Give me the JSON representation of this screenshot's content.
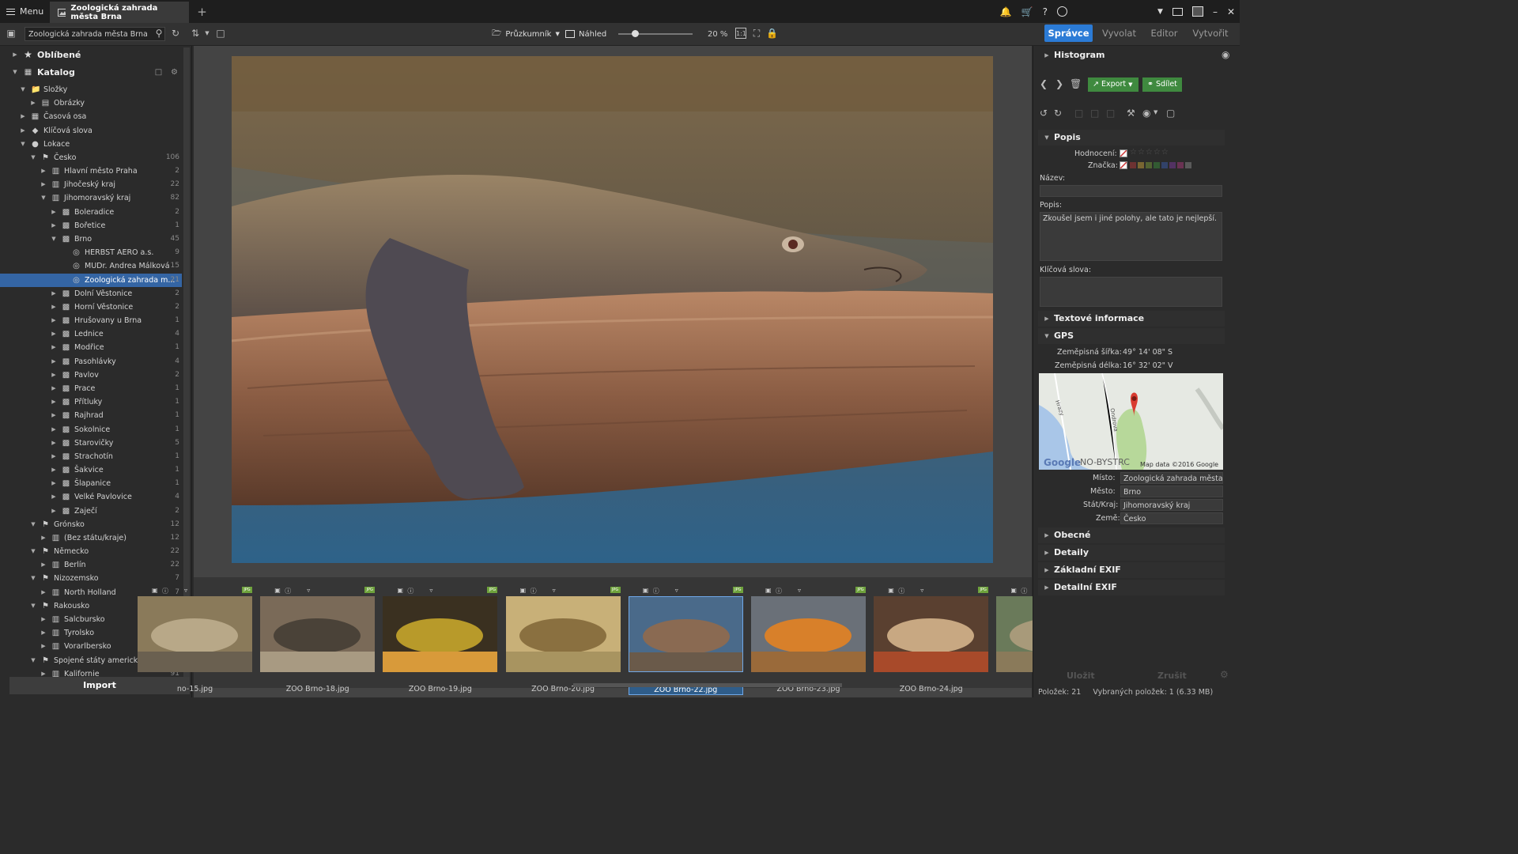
{
  "titlebar": {
    "menu_label": "Menu",
    "tab_title": "Zoologická zahrada města Brna",
    "icons": [
      "bell-icon",
      "cart-icon",
      "help-icon",
      "account-icon",
      "chevron-down-icon",
      "monitor-icon",
      "fullscreen-icon",
      "minimize-icon",
      "close-icon"
    ]
  },
  "toolbar": {
    "search_value": "Zoologická zahrada města Brna",
    "mode_explorer": "Průzkumník",
    "mode_preview": "Náhled",
    "zoom": "20 %",
    "zoom_slider_fraction": 0.2
  },
  "panel_tabs": [
    "Správce",
    "Vyvolat",
    "Editor",
    "Vytvořit"
  ],
  "left": {
    "favorites": "Oblíbené",
    "catalog": "Katalog",
    "import_label": "Import",
    "tree": [
      {
        "label": "Složky",
        "count": "",
        "depth": 1,
        "arrow": "open",
        "icon": "folder-icon"
      },
      {
        "label": "Obrázky",
        "count": "",
        "depth": 2,
        "arrow": "closed",
        "icon": "image-folder-icon"
      },
      {
        "label": "Časová osa",
        "count": "",
        "depth": 1,
        "arrow": "closed",
        "icon": "calendar-icon"
      },
      {
        "label": "Klíčová slova",
        "count": "",
        "depth": 1,
        "arrow": "closed",
        "icon": "tag-icon"
      },
      {
        "label": "Lokace",
        "count": "",
        "depth": 1,
        "arrow": "open",
        "icon": "pin-icon"
      },
      {
        "label": "Česko",
        "count": "106",
        "depth": 2,
        "arrow": "open",
        "icon": "flag-icon"
      },
      {
        "label": "Hlavní město Praha",
        "count": "2",
        "depth": 3,
        "arrow": "closed",
        "icon": "map-icon"
      },
      {
        "label": "Jihočeský kraj",
        "count": "22",
        "depth": 3,
        "arrow": "closed",
        "icon": "map-icon"
      },
      {
        "label": "Jihomoravský kraj",
        "count": "82",
        "depth": 3,
        "arrow": "open",
        "icon": "map-icon"
      },
      {
        "label": "Boleradice",
        "count": "2",
        "depth": 4,
        "arrow": "closed",
        "icon": "city-icon"
      },
      {
        "label": "Bořetice",
        "count": "1",
        "depth": 4,
        "arrow": "closed",
        "icon": "city-icon"
      },
      {
        "label": "Brno",
        "count": "45",
        "depth": 4,
        "arrow": "open",
        "icon": "city-icon"
      },
      {
        "label": "HERBST AERO a.s.",
        "count": "9",
        "depth": 5,
        "arrow": "",
        "icon": "place-icon"
      },
      {
        "label": "MUDr. Andrea Málková",
        "count": "15",
        "depth": 5,
        "arrow": "",
        "icon": "place-icon"
      },
      {
        "label": "Zoologická zahrada m...",
        "count": "21",
        "depth": 5,
        "arrow": "",
        "icon": "place-icon",
        "selected": true
      },
      {
        "label": "Dolní Věstonice",
        "count": "2",
        "depth": 4,
        "arrow": "closed",
        "icon": "city-icon"
      },
      {
        "label": "Horní Věstonice",
        "count": "2",
        "depth": 4,
        "arrow": "closed",
        "icon": "city-icon"
      },
      {
        "label": "Hrušovany u Brna",
        "count": "1",
        "depth": 4,
        "arrow": "closed",
        "icon": "city-icon"
      },
      {
        "label": "Lednice",
        "count": "4",
        "depth": 4,
        "arrow": "closed",
        "icon": "city-icon"
      },
      {
        "label": "Modřice",
        "count": "1",
        "depth": 4,
        "arrow": "closed",
        "icon": "city-icon"
      },
      {
        "label": "Pasohlávky",
        "count": "4",
        "depth": 4,
        "arrow": "closed",
        "icon": "city-icon"
      },
      {
        "label": "Pavlov",
        "count": "2",
        "depth": 4,
        "arrow": "closed",
        "icon": "city-icon"
      },
      {
        "label": "Prace",
        "count": "1",
        "depth": 4,
        "arrow": "closed",
        "icon": "city-icon"
      },
      {
        "label": "Přítluky",
        "count": "1",
        "depth": 4,
        "arrow": "closed",
        "icon": "city-icon"
      },
      {
        "label": "Rajhrad",
        "count": "1",
        "depth": 4,
        "arrow": "closed",
        "icon": "city-icon"
      },
      {
        "label": "Sokolnice",
        "count": "1",
        "depth": 4,
        "arrow": "closed",
        "icon": "city-icon"
      },
      {
        "label": "Starovičky",
        "count": "5",
        "depth": 4,
        "arrow": "closed",
        "icon": "city-icon"
      },
      {
        "label": "Strachotín",
        "count": "1",
        "depth": 4,
        "arrow": "closed",
        "icon": "city-icon"
      },
      {
        "label": "Šakvice",
        "count": "1",
        "depth": 4,
        "arrow": "closed",
        "icon": "city-icon"
      },
      {
        "label": "Šlapanice",
        "count": "1",
        "depth": 4,
        "arrow": "closed",
        "icon": "city-icon"
      },
      {
        "label": "Velké Pavlovice",
        "count": "4",
        "depth": 4,
        "arrow": "closed",
        "icon": "city-icon"
      },
      {
        "label": "Zaječí",
        "count": "2",
        "depth": 4,
        "arrow": "closed",
        "icon": "city-icon"
      },
      {
        "label": "Grónsko",
        "count": "12",
        "depth": 2,
        "arrow": "open",
        "icon": "flag-icon"
      },
      {
        "label": "(Bez státu/kraje)",
        "count": "12",
        "depth": 3,
        "arrow": "closed",
        "icon": "map-icon"
      },
      {
        "label": "Německo",
        "count": "22",
        "depth": 2,
        "arrow": "open",
        "icon": "flag-icon"
      },
      {
        "label": "Berlín",
        "count": "22",
        "depth": 3,
        "arrow": "closed",
        "icon": "map-icon"
      },
      {
        "label": "Nizozemsko",
        "count": "7",
        "depth": 2,
        "arrow": "open",
        "icon": "flag-icon"
      },
      {
        "label": "North Holland",
        "count": "7",
        "depth": 3,
        "arrow": "closed",
        "icon": "map-icon"
      },
      {
        "label": "Rakousko",
        "count": "22",
        "depth": 2,
        "arrow": "open",
        "icon": "flag-icon"
      },
      {
        "label": "Salcbursko",
        "count": "10",
        "depth": 3,
        "arrow": "closed",
        "icon": "map-icon"
      },
      {
        "label": "Tyrolsko",
        "count": "4",
        "depth": 3,
        "arrow": "closed",
        "icon": "map-icon"
      },
      {
        "label": "Vorarlbersko",
        "count": "8",
        "depth": 3,
        "arrow": "closed",
        "icon": "map-icon"
      },
      {
        "label": "Spojené státy americké",
        "count": "115",
        "depth": 2,
        "arrow": "open",
        "icon": "flag-icon"
      },
      {
        "label": "Kalifornie",
        "count": "91",
        "depth": 3,
        "arrow": "closed",
        "icon": "map-icon"
      }
    ]
  },
  "filmstrip": [
    {
      "name": "no-15.jpg",
      "scene": "deer"
    },
    {
      "name": "ZOO Brno-18.jpg",
      "scene": "lizard-rock"
    },
    {
      "name": "ZOO Brno-19.jpg",
      "scene": "lizard-yellow"
    },
    {
      "name": "ZOO Brno-20.jpg",
      "scene": "iguana"
    },
    {
      "name": "ZOO Brno-22.jpg",
      "scene": "komodo",
      "selected": true
    },
    {
      "name": "ZOO Brno-23.jpg",
      "scene": "iguana-orange"
    },
    {
      "name": "ZOO Brno-24.jpg",
      "scene": "prairie-dog"
    },
    {
      "name": "ZO",
      "scene": "partial"
    }
  ],
  "right": {
    "histogram": "Histogram",
    "export_label": "Export",
    "share_label": "Sdílet",
    "popis_section": "Popis",
    "rating_label": "Hodnocení:",
    "mark_label": "Značka:",
    "title_label": "Název:",
    "title_value": "",
    "desc_label": "Popis:",
    "desc_value": "Zkoušel jsem i jiné polohy, ale tato je nejlepší.",
    "keywords_label": "Klíčová slova:",
    "text_info_section": "Textové informace",
    "gps_section": "GPS",
    "lat_label": "Zeměpisná šířka:",
    "lat_value": "49° 14' 08\" S",
    "lon_label": "Zeměpisná délka:",
    "lon_value": "16° 32' 02\" V",
    "map_google": "Google",
    "map_place_text": "NO-BYSTRC",
    "map_credit": "Map data ©2016 Google",
    "map_street1": "Hrazy",
    "map_street2": "Ondrova",
    "place_label": "Místo:",
    "place_value": "Zoologická zahrada města Br",
    "city_label": "Město:",
    "city_value": "Brno",
    "state_label": "Stát/Kraj:",
    "state_value": "Jihomoravský kraj",
    "country_label": "Země:",
    "country_value": "Česko",
    "sections_collapsed": [
      "Obecné",
      "Detaily",
      "Základní EXIF",
      "Detailní EXIF"
    ],
    "save_label": "Uložit",
    "cancel_label": "Zrušit",
    "status_count": "Položek: 21",
    "status_selected": "Vybraných položek: 1 (6.33 MB)",
    "mark_colors": [
      "#b03a3a",
      "#c8a23a",
      "#7a9a3a",
      "#3a8a3a",
      "#3a5aa8",
      "#7a3a9a",
      "#a83a7a",
      "#888888"
    ]
  }
}
